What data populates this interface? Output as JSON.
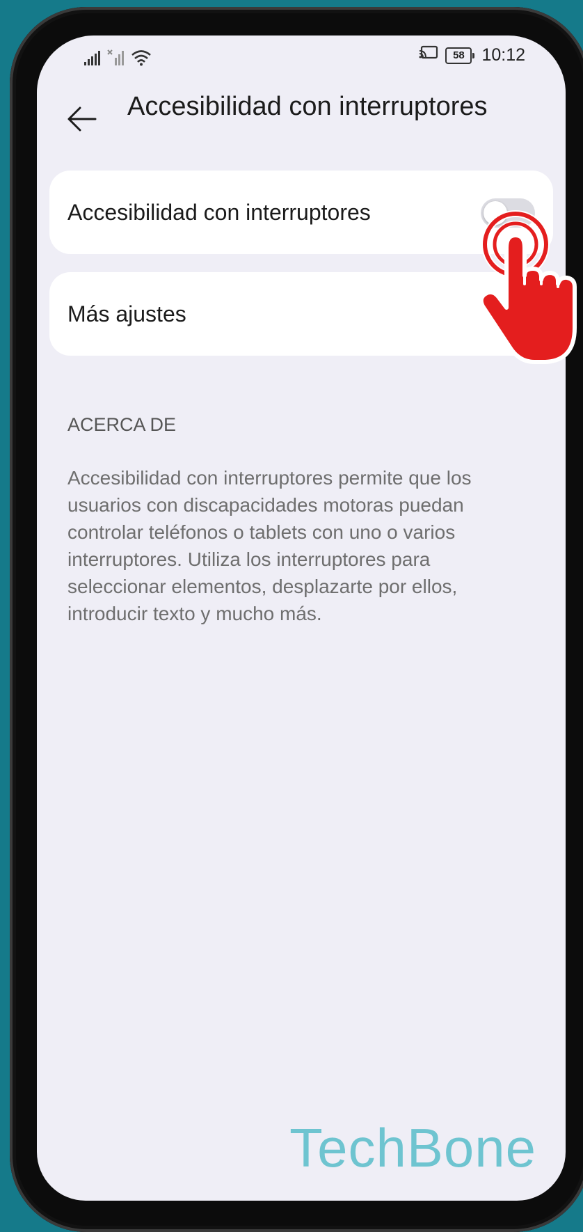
{
  "status_bar": {
    "signal_icon": "signal-bars-icon",
    "signal_icon_2": "signal-bars-x-icon",
    "wifi_icon": "wifi-icon",
    "cast_icon": "screen-cast-icon",
    "battery_level": "58",
    "time": "10:12"
  },
  "header": {
    "back_icon": "arrow-left-icon",
    "title": "Accesibilidad con interruptores"
  },
  "settings": {
    "toggle_row": {
      "label": "Accesibilidad con interruptores",
      "enabled": false
    },
    "more_row": {
      "label": "Más ajustes"
    }
  },
  "about": {
    "section_title": "ACERCA DE",
    "text": "Accesibilidad con interruptores permite que los usuarios con discapacidades motoras puedan controlar teléfonos o tablets con uno o varios interruptores. Utiliza los interruptores para seleccionar elementos, desplazarte por ellos, introducir texto y mucho más."
  },
  "overlay": {
    "tap_hand_icon": "tap-hand-icon",
    "watermark": "TechBone"
  },
  "colors": {
    "background": "#157a8a",
    "screen": "#efeef6",
    "card": "#ffffff",
    "hand": "#e41e1e",
    "watermark": "#6ec4d0"
  }
}
